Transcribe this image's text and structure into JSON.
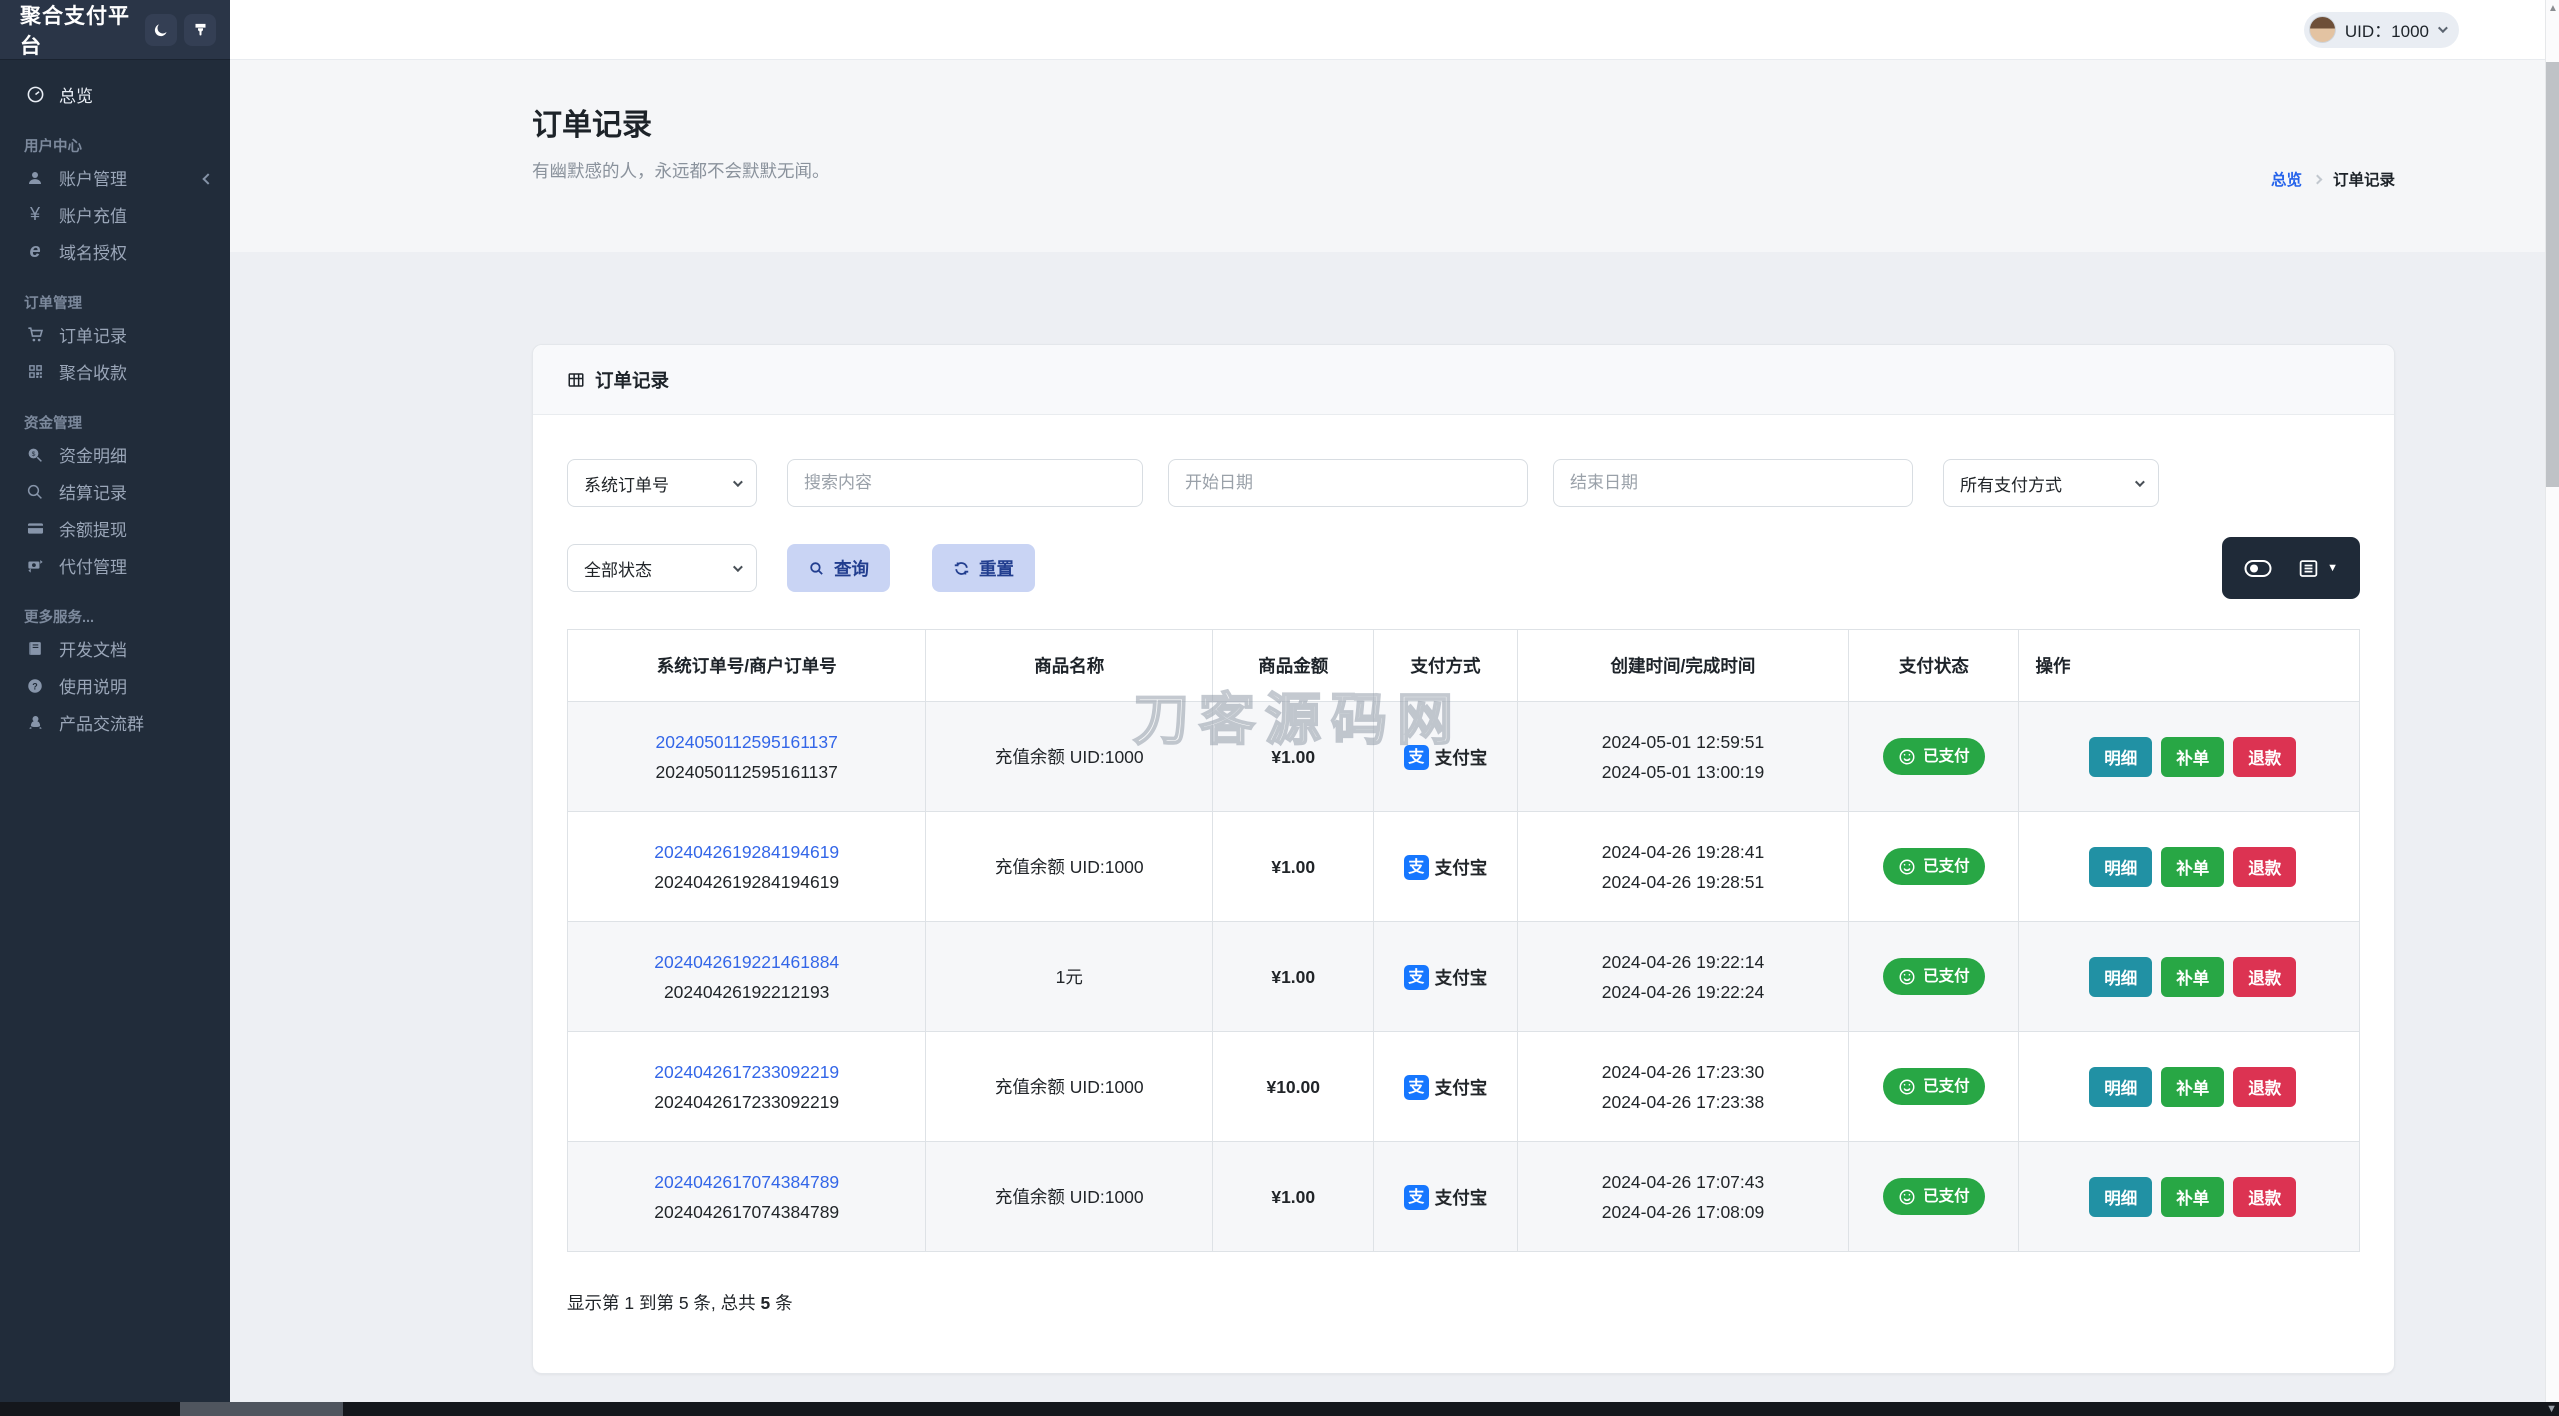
{
  "app": {
    "title": "聚合支付平台"
  },
  "topbar": {
    "uid_label": "UID：1000"
  },
  "sidebar": {
    "overview": "总览",
    "sections": [
      {
        "label": "用户中心",
        "items": [
          "账户管理",
          "账户充值",
          "域名授权"
        ]
      },
      {
        "label": "订单管理",
        "items": [
          "订单记录",
          "聚合收款"
        ]
      },
      {
        "label": "资金管理",
        "items": [
          "资金明细",
          "结算记录",
          "余额提现",
          "代付管理"
        ]
      },
      {
        "label": "更多服务...",
        "items": [
          "开发文档",
          "使用说明",
          "产品交流群"
        ]
      }
    ]
  },
  "page": {
    "title": "订单记录",
    "subtitle": "有幽默感的人，永远都不会默默无闻。",
    "breadcrumb_home": "总览",
    "breadcrumb_current": "订单记录"
  },
  "card": {
    "header": "订单记录"
  },
  "filters": {
    "order_type_select": "系统订单号",
    "search_placeholder": "搜索内容",
    "start_date_placeholder": "开始日期",
    "end_date_placeholder": "结束日期",
    "pay_method_select": "所有支付方式",
    "status_select": "全部状态",
    "query_label": "查询",
    "reset_label": "重置"
  },
  "table": {
    "columns": [
      "系统订单号/商户订单号",
      "商品名称",
      "商品金额",
      "支付方式",
      "创建时间/完成时间",
      "支付状态",
      "操作"
    ],
    "alipay_glyph": "支",
    "action_labels": [
      "明细",
      "补单",
      "退款"
    ],
    "rows": [
      {
        "sys_no": "2024050112595161137",
        "merchant_no": "2024050112595161137",
        "product": "充值余额 UID:1000",
        "amount": "¥1.00",
        "method": "支付宝",
        "created": "2024-05-01 12:59:51",
        "completed": "2024-05-01 13:00:19",
        "status": "已支付"
      },
      {
        "sys_no": "2024042619284194619",
        "merchant_no": "2024042619284194619",
        "product": "充值余额 UID:1000",
        "amount": "¥1.00",
        "method": "支付宝",
        "created": "2024-04-26 19:28:41",
        "completed": "2024-04-26 19:28:51",
        "status": "已支付"
      },
      {
        "sys_no": "2024042619221461884",
        "merchant_no": "20240426192212193",
        "product": "1元",
        "amount": "¥1.00",
        "method": "支付宝",
        "created": "2024-04-26 19:22:14",
        "completed": "2024-04-26 19:22:24",
        "status": "已支付"
      },
      {
        "sys_no": "2024042617233092219",
        "merchant_no": "2024042617233092219",
        "product": "充值余额 UID:1000",
        "amount": "¥10.00",
        "method": "支付宝",
        "created": "2024-04-26 17:23:30",
        "completed": "2024-04-26 17:23:38",
        "status": "已支付"
      },
      {
        "sys_no": "2024042617074384789",
        "merchant_no": "2024042617074384789",
        "product": "充值余额 UID:1000",
        "amount": "¥1.00",
        "method": "支付宝",
        "created": "2024-04-26 17:07:43",
        "completed": "2024-04-26 17:08:09",
        "status": "已支付"
      }
    ],
    "summary_prefix": "显示第 1 到第 5 条, 总共 ",
    "summary_total": "5",
    "summary_suffix": " 条"
  },
  "watermark": "刀客源码网",
  "colors": {
    "sidebar_bg": "#212c3a",
    "accent_blue": "#2563eb",
    "link_blue": "#3366e8",
    "alipay_blue": "#1677ff",
    "paid_green": "#28a745",
    "detail_teal": "#2191a4",
    "supplement_green": "#28a745",
    "refund_red": "#dc3352"
  }
}
